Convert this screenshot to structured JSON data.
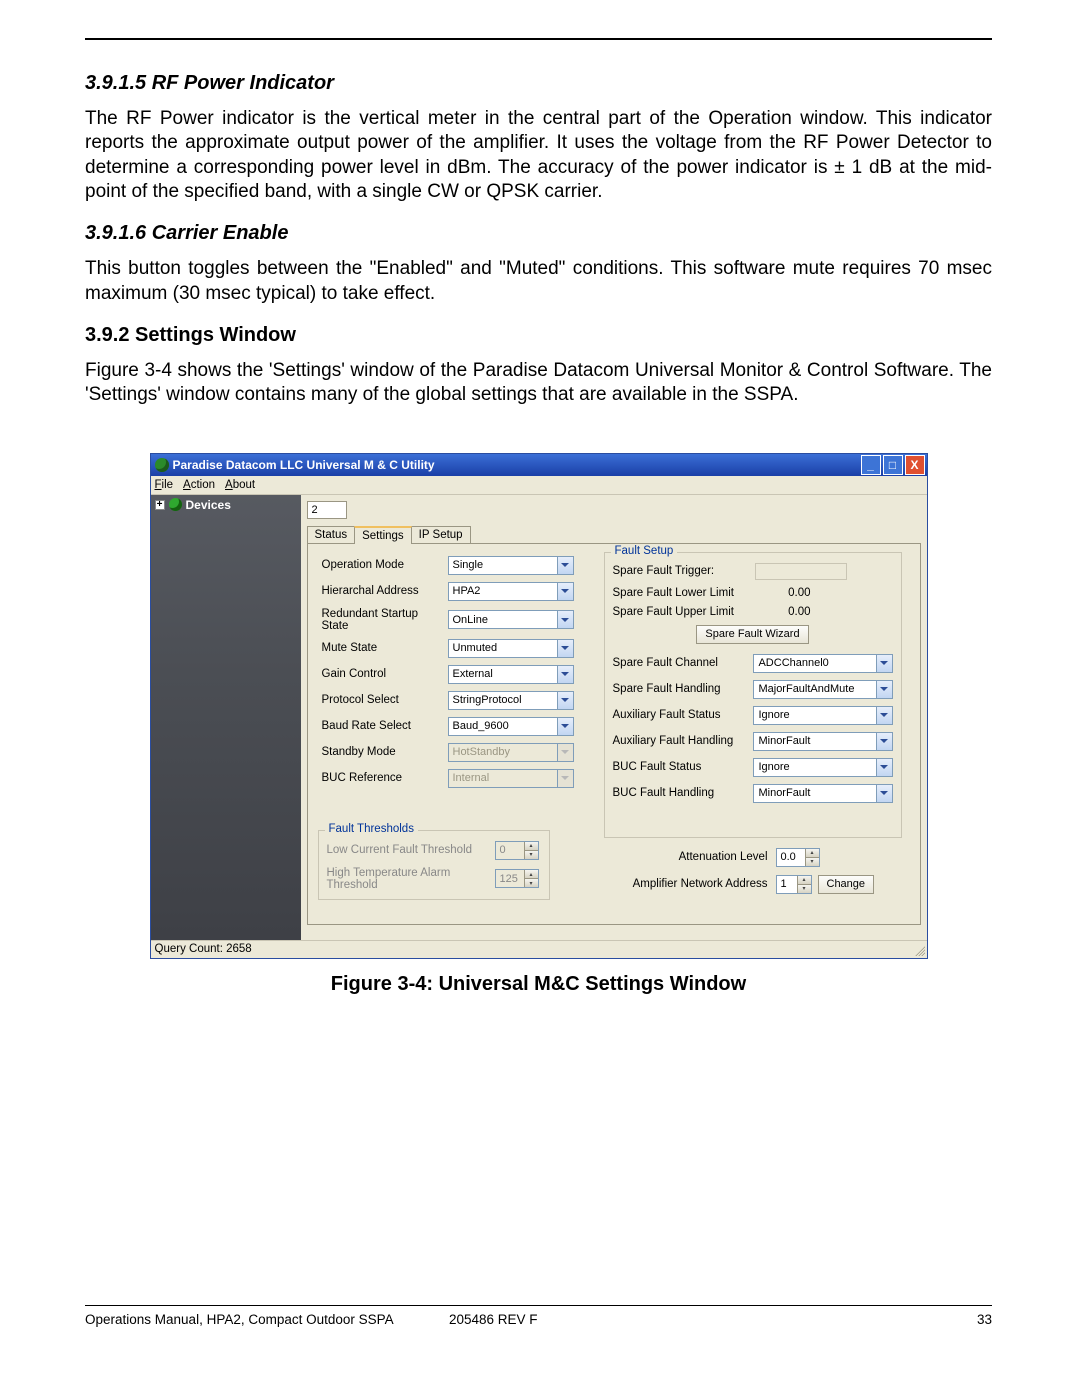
{
  "sections": {
    "s1_heading": "3.9.1.5 RF Power Indicator",
    "s1_body": "The RF Power indicator is the vertical meter in the central part of the Operation window. This indicator reports the approximate output power of the amplifier. It uses the voltage from the RF Power Detector to determine a corresponding power level in dBm. The accuracy of the power indicator is ± 1 dB at the mid-point of the specified band, with a single CW or QPSK carrier.",
    "s2_heading": "3.9.1.6 Carrier Enable",
    "s2_body": "This button toggles between the \"Enabled\" and \"Muted\" conditions. This software mute requires 70 msec maximum (30 msec typical) to take effect.",
    "s3_heading": "3.9.2 Settings Window",
    "s3_body": "Figure 3-4 shows the 'Settings' window of the Paradise Datacom Universal Monitor & Control Software. The 'Settings' window contains many of the global settings that are available in the SSPA."
  },
  "figure_caption": "Figure 3-4: Universal M&C Settings Window",
  "footer": {
    "left": "Operations Manual, HPA2, Compact Outdoor SSPA",
    "mid": "205486 REV F",
    "right": "33"
  },
  "window": {
    "title": "Paradise Datacom LLC Universal M & C Utility",
    "menus": {
      "file": "File",
      "action": "Action",
      "about": "About"
    },
    "tree_root": "Devices",
    "id_value": "2",
    "tabs": {
      "status": "Status",
      "settings": "Settings",
      "ipsetup": "IP Setup"
    },
    "left_settings": {
      "operation_mode": {
        "label": "Operation Mode",
        "value": "Single"
      },
      "hierarchal_address": {
        "label": "Hierarchal Address",
        "value": "HPA2"
      },
      "redundant_startup": {
        "label": "Redundant Startup State",
        "value": "OnLine"
      },
      "mute_state": {
        "label": "Mute State",
        "value": "Unmuted"
      },
      "gain_control": {
        "label": "Gain Control",
        "value": "External"
      },
      "protocol_select": {
        "label": "Protocol Select",
        "value": "StringProtocol"
      },
      "baud_rate": {
        "label": "Baud Rate Select",
        "value": "Baud_9600"
      },
      "standby_mode": {
        "label": "Standby Mode",
        "value": "HotStandby"
      },
      "buc_reference": {
        "label": "BUC Reference",
        "value": "Internal"
      }
    },
    "fault_thresholds": {
      "legend": "Fault Thresholds",
      "low_current": {
        "label": "Low Current Fault Threshold",
        "value": "0"
      },
      "high_temp": {
        "label": "High Temperature Alarm Threshold",
        "value": "125"
      }
    },
    "fault_setup": {
      "legend": "Fault Setup",
      "trigger_label": "Spare Fault Trigger:",
      "lower_label": "Spare Fault Lower Limit",
      "lower_value": "0.00",
      "upper_label": "Spare Fault Upper Limit",
      "upper_value": "0.00",
      "wizard_btn": "Spare Fault Wizard",
      "channel": {
        "label": "Spare Fault Channel",
        "value": "ADCChannel0"
      },
      "handling": {
        "label": "Spare Fault Handling",
        "value": "MajorFaultAndMute"
      },
      "aux_status": {
        "label": "Auxiliary Fault Status",
        "value": "Ignore"
      },
      "aux_handling": {
        "label": "Auxiliary Fault Handling",
        "value": "MinorFault"
      },
      "buc_status": {
        "label": "BUC Fault Status",
        "value": "Ignore"
      },
      "buc_handling": {
        "label": "BUC Fault Handling",
        "value": "MinorFault"
      }
    },
    "bottom_right": {
      "atten_label": "Attenuation Level",
      "atten_value": "0.0",
      "addr_label": "Amplifier Network Address",
      "addr_value": "1",
      "change_btn": "Change"
    },
    "status_bar": "Query Count: 2658"
  }
}
